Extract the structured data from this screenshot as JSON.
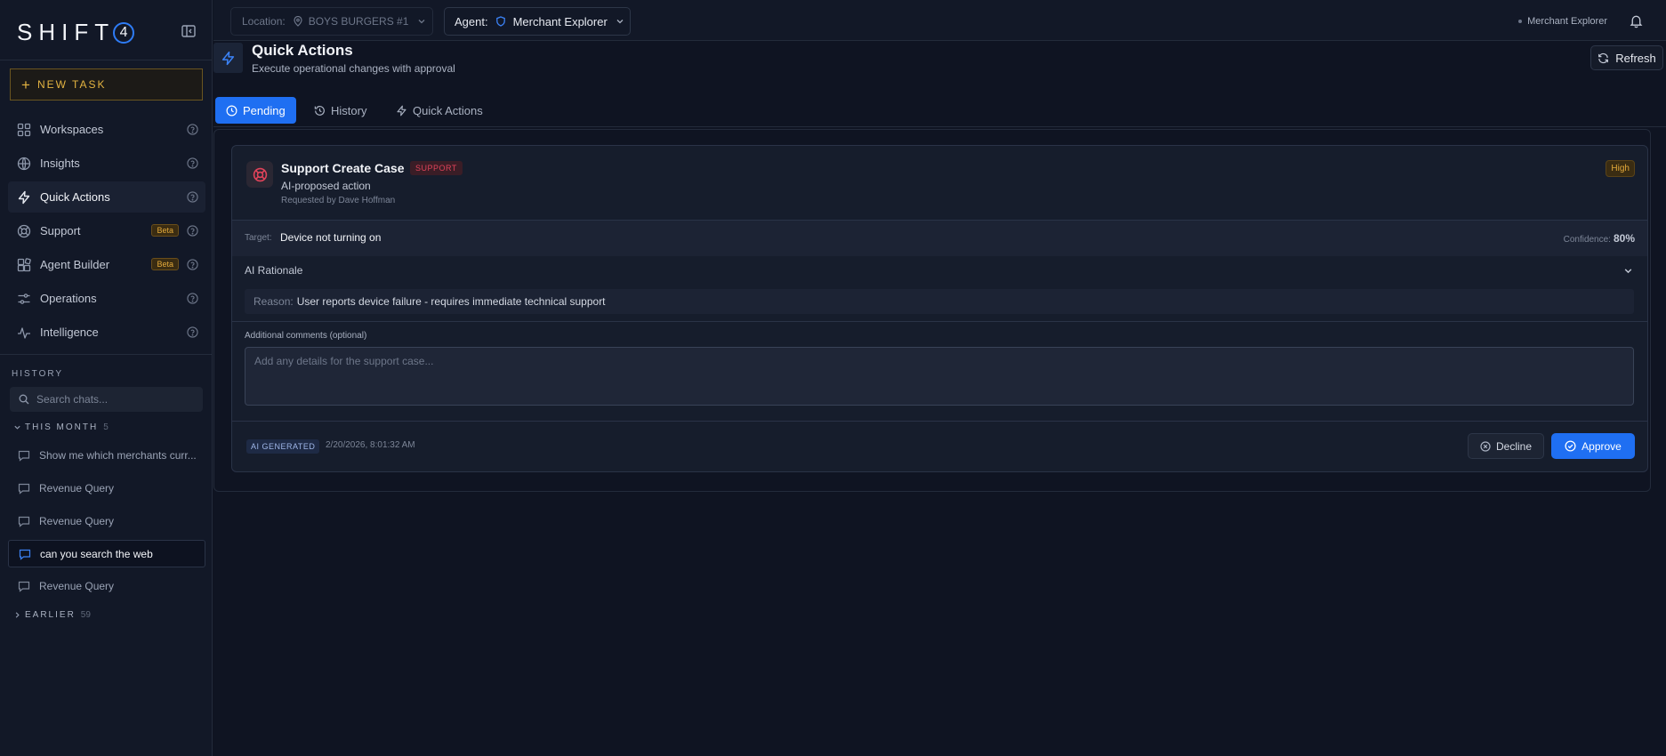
{
  "brand": {
    "logo_text": "SHIFT",
    "logo_digit": "4"
  },
  "sidebar": {
    "new_task_label": "NEW TASK",
    "nav": [
      {
        "label": "Workspaces",
        "icon": "grid-icon"
      },
      {
        "label": "Insights",
        "icon": "globe-icon"
      },
      {
        "label": "Quick Actions",
        "icon": "lightning-icon"
      },
      {
        "label": "Support",
        "icon": "lifebuoy-icon",
        "badge": "Beta"
      },
      {
        "label": "Agent Builder",
        "icon": "blocks-icon",
        "badge": "Beta"
      },
      {
        "label": "Operations",
        "icon": "sliders-icon"
      },
      {
        "label": "Intelligence",
        "icon": "pulse-icon"
      }
    ],
    "history_title": "HISTORY",
    "search_placeholder": "Search chats...",
    "groups": [
      {
        "label": "THIS MONTH",
        "count": "5"
      },
      {
        "label": "EARLIER",
        "count": "59"
      }
    ],
    "chats": [
      "Show me which merchants curr...",
      "Revenue Query",
      "Revenue Query",
      "can you search the web",
      "Revenue Query"
    ]
  },
  "topbar": {
    "location_label": "Location:",
    "location_value": "BOYS BURGERS #1",
    "agent_label": "Agent:",
    "agent_value": "Merchant Explorer",
    "right_label": "Merchant Explorer"
  },
  "header": {
    "title": "Quick Actions",
    "subtitle": "Execute operational changes with approval",
    "refresh_label": "Refresh"
  },
  "tabs": [
    {
      "label": "Pending",
      "icon": "clock-icon"
    },
    {
      "label": "History",
      "icon": "history-icon"
    },
    {
      "label": "Quick Actions",
      "icon": "lightning-icon"
    }
  ],
  "card": {
    "title": "Support Create Case",
    "tag": "SUPPORT",
    "subtitle": "AI-proposed action",
    "requested_by": "Requested by Dave Hoffman",
    "priority": "High",
    "target_label": "Target:",
    "target_value": "Device not turning on",
    "confidence_label": "Confidence:",
    "confidence_value": "80%",
    "rationale_label": "AI Rationale",
    "reason_label": "Reason:",
    "reason_value": "User reports device failure - requires immediate technical support",
    "comments_label": "Additional comments (optional)",
    "comments_placeholder": "Add any details for the support case...",
    "ai_badge": "AI GENERATED",
    "timestamp": "2/20/2026, 8:01:32 AM",
    "decline_label": "Decline",
    "approve_label": "Approve"
  },
  "colors": {
    "accent": "#1f6ff2",
    "gold": "#e3b341",
    "danger": "#e0435a",
    "background": "#0f1422"
  }
}
